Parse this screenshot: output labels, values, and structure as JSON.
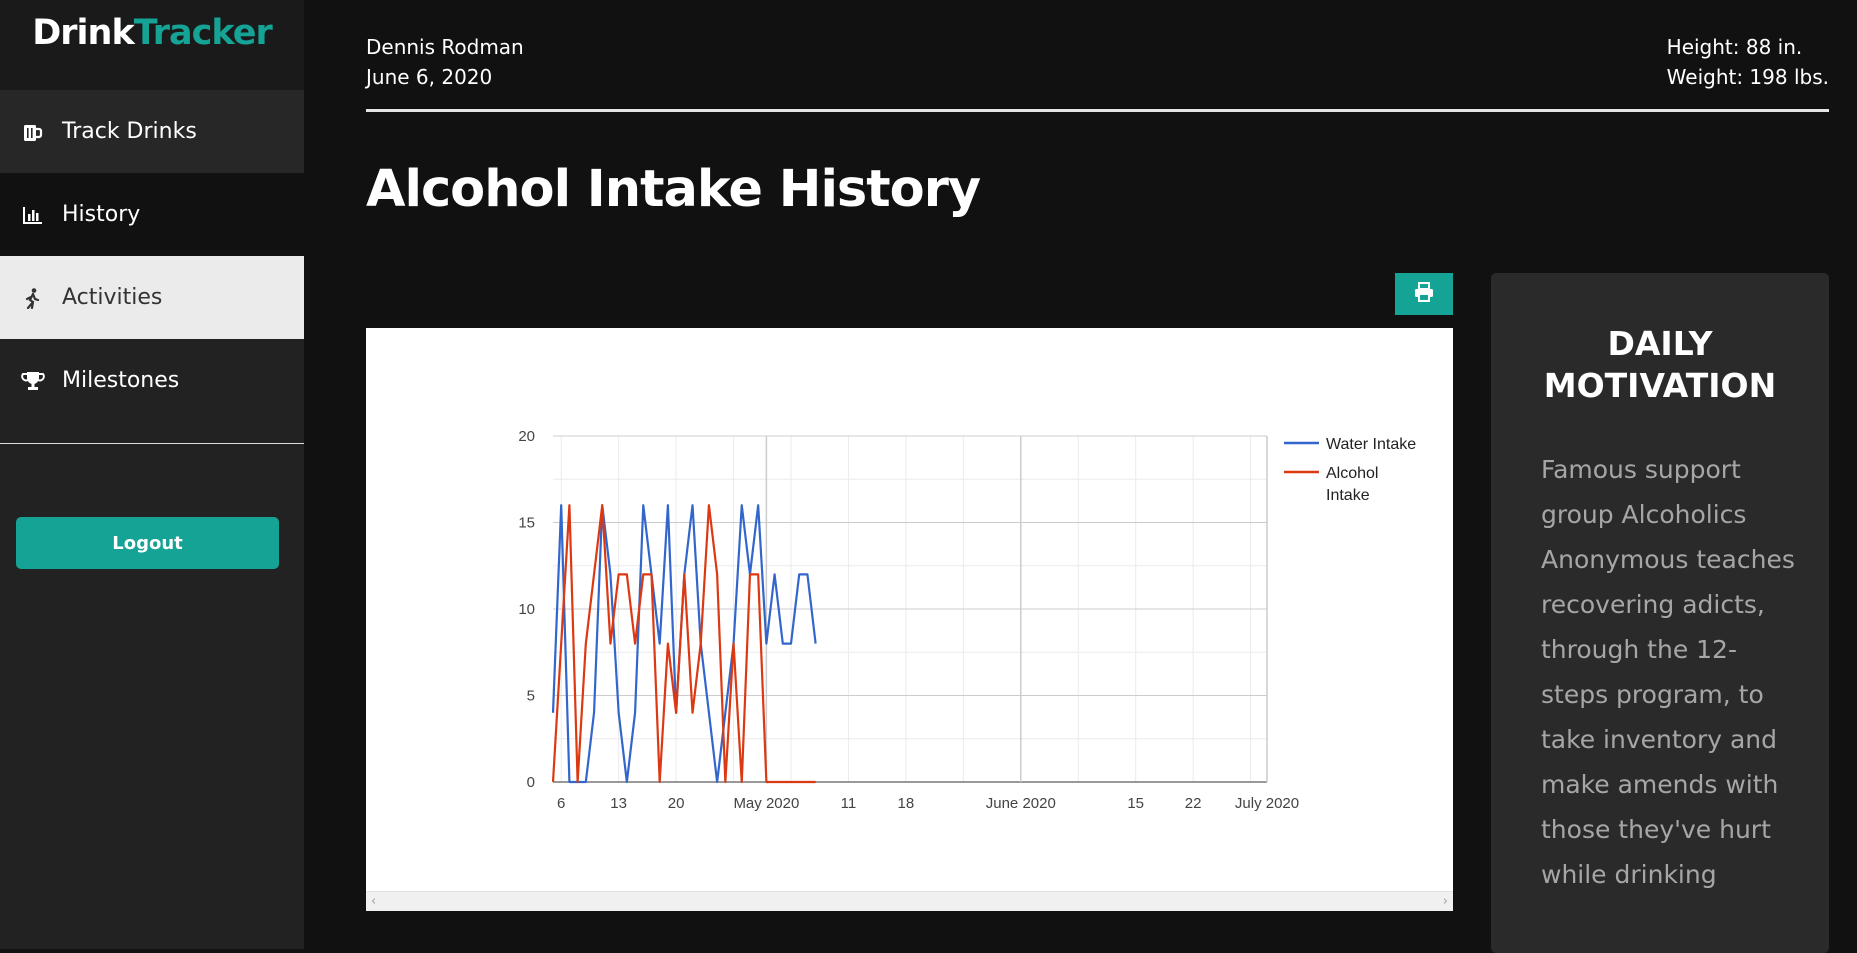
{
  "brand": {
    "part1": "Drink",
    "part2": "Tracker"
  },
  "nav": [
    {
      "label": "Track Drinks",
      "icon": "beer-mug-icon"
    },
    {
      "label": "History",
      "icon": "bar-chart-icon"
    },
    {
      "label": "Activities",
      "icon": "walking-person-icon"
    },
    {
      "label": "Milestones",
      "icon": "trophy-icon"
    }
  ],
  "logout_label": "Logout",
  "header": {
    "name": "Dennis Rodman",
    "date": "June 6, 2020",
    "height": "Height: 88 in.",
    "weight": "Weight: 198 lbs."
  },
  "page_title": "Alcohol Intake History",
  "print_icon": "printer-icon",
  "colors": {
    "accent": "#14a394",
    "water": "#3366cc",
    "alcohol": "#dc3912"
  },
  "motivation": {
    "title_line1": "DAILY",
    "title_line2": "MOTIVATION",
    "text": "Famous support group Alcoholics Anonymous teaches recovering adicts, through the 12-steps program, to take inventory and make amends with those they've hurt while drinking"
  },
  "chart_data": {
    "type": "line",
    "xlabel": "",
    "ylabel": "",
    "ylim": [
      0,
      20
    ],
    "xlim": [
      "2020-04-05",
      "2020-07-01"
    ],
    "yticks": [
      0,
      5,
      10,
      15,
      20
    ],
    "xticks": [
      {
        "date": "2020-04-06",
        "label": "6"
      },
      {
        "date": "2020-04-13",
        "label": "13"
      },
      {
        "date": "2020-04-20",
        "label": "20"
      },
      {
        "date": "2020-05-01",
        "label": "May 2020"
      },
      {
        "date": "2020-05-11",
        "label": "11"
      },
      {
        "date": "2020-05-18",
        "label": "18"
      },
      {
        "date": "2020-06-01",
        "label": "June 2020"
      },
      {
        "date": "2020-06-15",
        "label": "15"
      },
      {
        "date": "2020-06-22",
        "label": "22"
      },
      {
        "date": "2020-07-01",
        "label": "July 2020"
      }
    ],
    "grid": true,
    "legend_position": "right",
    "series": [
      {
        "name": "Water Intake",
        "x": [
          "2020-04-05",
          "2020-04-06",
          "2020-04-07",
          "2020-04-08",
          "2020-04-09",
          "2020-04-10",
          "2020-04-11",
          "2020-04-12",
          "2020-04-13",
          "2020-04-14",
          "2020-04-15",
          "2020-04-16",
          "2020-04-17",
          "2020-04-18",
          "2020-04-19",
          "2020-04-20",
          "2020-04-21",
          "2020-04-22",
          "2020-04-23",
          "2020-04-24",
          "2020-04-25",
          "2020-04-26",
          "2020-04-27",
          "2020-04-28",
          "2020-04-29",
          "2020-04-30",
          "2020-05-01",
          "2020-05-02",
          "2020-05-03",
          "2020-05-04",
          "2020-05-05",
          "2020-05-06",
          "2020-05-07"
        ],
        "values": [
          4,
          16,
          0,
          0,
          0,
          4,
          16,
          12,
          4,
          0,
          4,
          16,
          12,
          8,
          16,
          4,
          12,
          16,
          8,
          4,
          0,
          4,
          8,
          16,
          12,
          16,
          8,
          12,
          8,
          8,
          12,
          12,
          8
        ]
      },
      {
        "name": "Alcohol Intake",
        "x": [
          "2020-04-05",
          "2020-04-06",
          "2020-04-07",
          "2020-04-08",
          "2020-04-09",
          "2020-04-10",
          "2020-04-11",
          "2020-04-12",
          "2020-04-13",
          "2020-04-14",
          "2020-04-15",
          "2020-04-16",
          "2020-04-17",
          "2020-04-18",
          "2020-04-19",
          "2020-04-20",
          "2020-04-21",
          "2020-04-22",
          "2020-04-23",
          "2020-04-24",
          "2020-04-25",
          "2020-04-26",
          "2020-04-27",
          "2020-04-28",
          "2020-04-29",
          "2020-04-30",
          "2020-05-01",
          "2020-05-02",
          "2020-05-03",
          "2020-05-04",
          "2020-05-05",
          "2020-05-06",
          "2020-05-07"
        ],
        "values": [
          0,
          8,
          16,
          0,
          8,
          12,
          16,
          8,
          12,
          12,
          8,
          12,
          12,
          0,
          8,
          4,
          12,
          4,
          8,
          16,
          12,
          0,
          8,
          0,
          12,
          12,
          0,
          0,
          0,
          0,
          0,
          0,
          0
        ]
      }
    ]
  }
}
